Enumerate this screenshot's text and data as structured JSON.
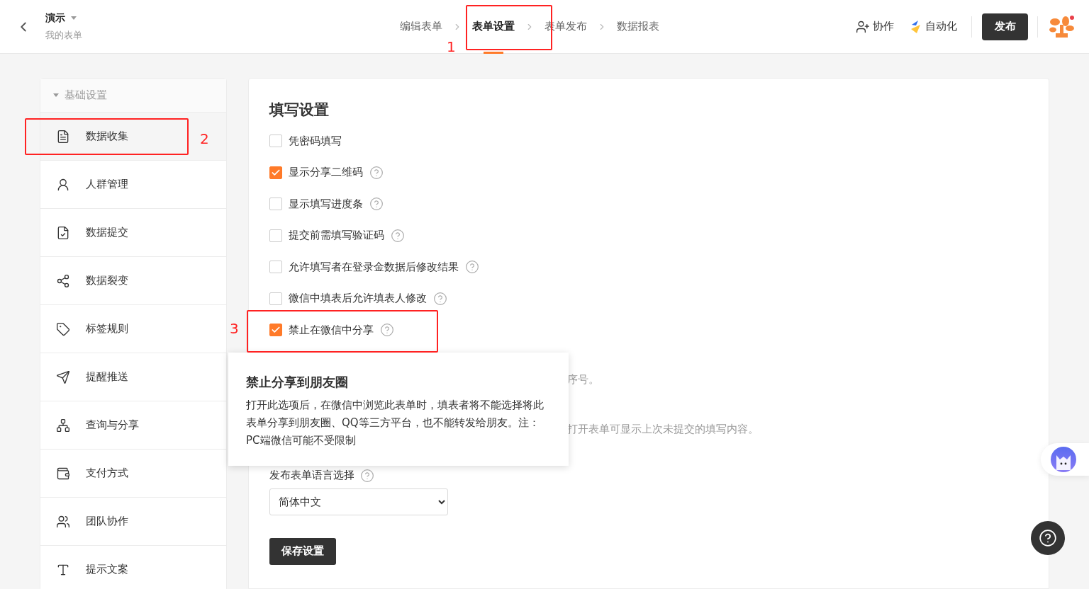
{
  "header": {
    "title": "演示",
    "subtitle": "我的表单",
    "steps": [
      {
        "label": "编辑表单",
        "selected": false
      },
      {
        "label": "表单设置",
        "selected": true
      },
      {
        "label": "表单发布",
        "selected": false
      },
      {
        "label": "数据报表",
        "selected": false
      }
    ],
    "actions": [
      {
        "kind": "collab",
        "label": "协作"
      },
      {
        "kind": "automation",
        "label": "自动化"
      }
    ],
    "publish": "发布"
  },
  "sidebar": {
    "group": "基础设置",
    "expanded": true,
    "items": [
      {
        "label": "数据收集",
        "selected": true
      },
      {
        "label": "人群管理",
        "selected": false
      },
      {
        "label": "数据提交",
        "selected": false
      },
      {
        "label": "数据裂变",
        "selected": false
      },
      {
        "label": "标签规则",
        "selected": false
      },
      {
        "label": "提醒推送",
        "selected": false
      },
      {
        "label": "查询与分享",
        "selected": false
      },
      {
        "label": "支付方式",
        "selected": false
      },
      {
        "label": "团队协作",
        "selected": false
      },
      {
        "label": "提示文案",
        "selected": false
      }
    ]
  },
  "panel": {
    "title": "填写设置",
    "options": [
      {
        "label": "凭密码填写",
        "checked": false,
        "help": false
      },
      {
        "label": "显示分享二维码",
        "checked": true,
        "help": true
      },
      {
        "label": "显示填写进度条",
        "checked": false,
        "help": true
      },
      {
        "label": "提交前需填写验证码",
        "checked": false,
        "help": true
      },
      {
        "label": "允许填写者在登录金数据后修改结果",
        "checked": false,
        "help": true
      },
      {
        "label": "微信中填表后允许填表人修改",
        "checked": false,
        "help": true
      },
      {
        "label": "禁止在微信中分享",
        "checked": true,
        "help": true
      }
    ],
    "hidden_notes": [
      "序号。",
      "打开表单可显示上次未提交的填写内容。"
    ],
    "language": {
      "label": "发布表单语言选择",
      "value": "简体中文"
    },
    "save": "保存设置"
  },
  "tooltip": {
    "title": "禁止分享到朋友圈",
    "body": "打开此选项后，在微信中浏览此表单时，填表者将不能选择将此表单分享到朋友圈、QQ等三方平台，也不能转发给朋友。注：PC端微信可能不受限制"
  },
  "annotations": [
    {
      "number": "1"
    },
    {
      "number": "2"
    },
    {
      "number": "3"
    }
  ]
}
